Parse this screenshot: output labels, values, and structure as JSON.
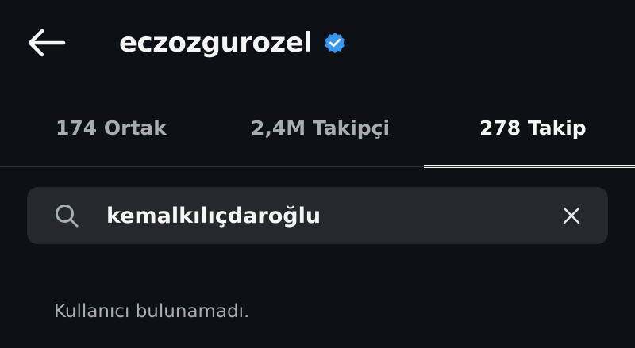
{
  "header": {
    "title": "eczozgurozel",
    "back_icon": "arrow-left-icon",
    "verified_icon": "verified-badge-icon",
    "verified_color": "#3897f0"
  },
  "tabs": [
    {
      "label": "174 Ortak",
      "active": false
    },
    {
      "label": "2,4M Takipçi",
      "active": false
    },
    {
      "label": "278 Takip",
      "active": true
    }
  ],
  "search": {
    "value": "kemalkılıçdaroğlu",
    "icon": "search-icon",
    "clear_icon": "close-icon"
  },
  "results": {
    "empty_message": "Kullanıcı bulunamadı."
  },
  "colors": {
    "background": "#0d1014",
    "search_bg": "#25282d",
    "text_primary": "#f5f5f5",
    "text_secondary": "#a8adb3"
  }
}
